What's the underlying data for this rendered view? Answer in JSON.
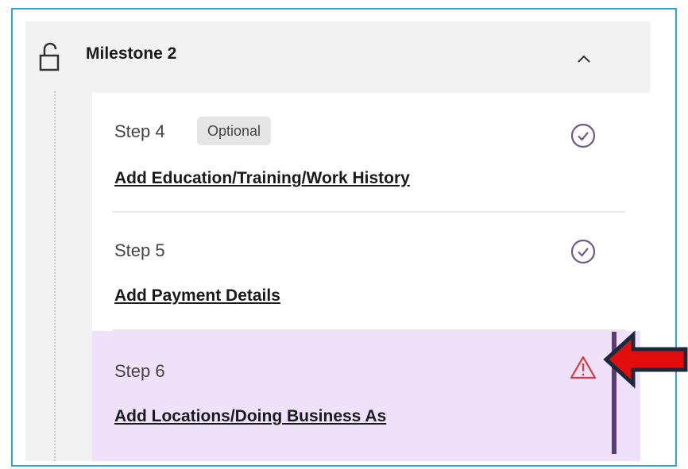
{
  "milestone": {
    "title": "Milestone 2"
  },
  "steps": [
    {
      "label": "Step 4",
      "badge": "Optional",
      "link": "Add Education/Training/Work History",
      "status": "check-circle-icon"
    },
    {
      "label": "Step 5",
      "link": "Add Payment Details",
      "status": "check-circle-icon"
    },
    {
      "label": "Step 6",
      "link": "Add Locations/Doing Business As",
      "status": "warning-triangle-icon"
    }
  ],
  "colors": {
    "frame_border": "#2aa7e0",
    "active_step_bg": "#efe1f9",
    "active_bar": "#5a3d73",
    "check_icon": "#6e5a86",
    "warning_icon": "#d23c3c",
    "arrow_fill": "#e40d0d",
    "arrow_outline": "#1b2a3a"
  }
}
